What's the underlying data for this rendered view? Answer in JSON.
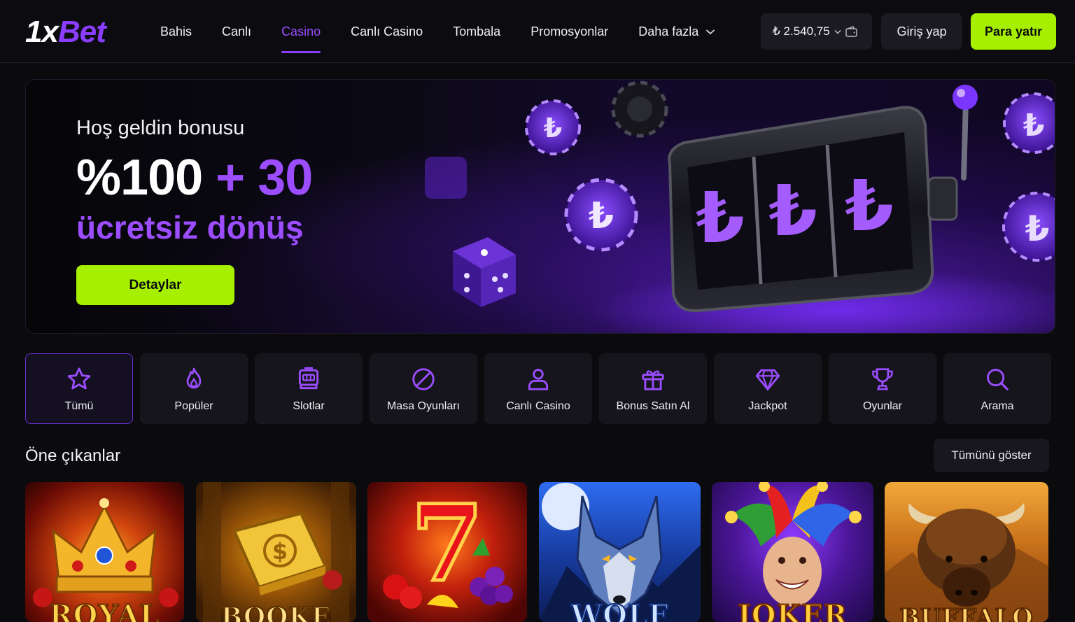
{
  "header": {
    "logo_one": "1x",
    "logo_bet": "Bet",
    "nav": [
      {
        "label": "Bahis"
      },
      {
        "label": "Canlı"
      },
      {
        "label": "Casino"
      },
      {
        "label": "Canlı Casino"
      },
      {
        "label": "Tombala"
      },
      {
        "label": "Promosyonlar"
      },
      {
        "label": "Daha fazla"
      }
    ],
    "active_nav": "Casino",
    "balance": "₺ 2.540,75",
    "login_label": "Giriş yap",
    "deposit_label": "Para yatır"
  },
  "banner": {
    "subtitle": "Hoş geldin bonusu",
    "percent": "%100",
    "plus_value": "+ 30",
    "spins": "ücretsiz dönüş",
    "button_label": "Detaylar",
    "reel_symbol": "₺"
  },
  "categories": [
    {
      "label": "Tümü",
      "icon": "star-icon",
      "active": true
    },
    {
      "label": "Popüler",
      "icon": "flame-icon"
    },
    {
      "label": "Slotlar",
      "icon": "slot-machine-icon"
    },
    {
      "label": "Masa Oyunları",
      "icon": "no-sign-icon"
    },
    {
      "label": "Canlı Casino",
      "icon": "user-icon"
    },
    {
      "label": "Bonus Satın Al",
      "icon": "gift-icon"
    },
    {
      "label": "Jackpot",
      "icon": "diamond-icon"
    },
    {
      "label": "Oyunlar",
      "icon": "trophy-icon"
    },
    {
      "label": "Arama",
      "icon": "search-icon"
    }
  ],
  "featured": {
    "title": "Öne çıkanlar",
    "show_all_label": "Tümünü göster",
    "games": [
      {
        "title": "ROYAL",
        "theme": "crown"
      },
      {
        "title": "BOOKE",
        "theme": "book"
      },
      {
        "title": "",
        "theme": "seven-fruits"
      },
      {
        "title": "WOLF",
        "theme": "wolf"
      },
      {
        "title": "JOKER",
        "theme": "jester"
      },
      {
        "title": "BUFFALO",
        "theme": "buffalo"
      }
    ]
  },
  "colors": {
    "accent_purple": "#8b3dff",
    "accent_green": "#a6ef00",
    "background": "#0b0b0e"
  }
}
